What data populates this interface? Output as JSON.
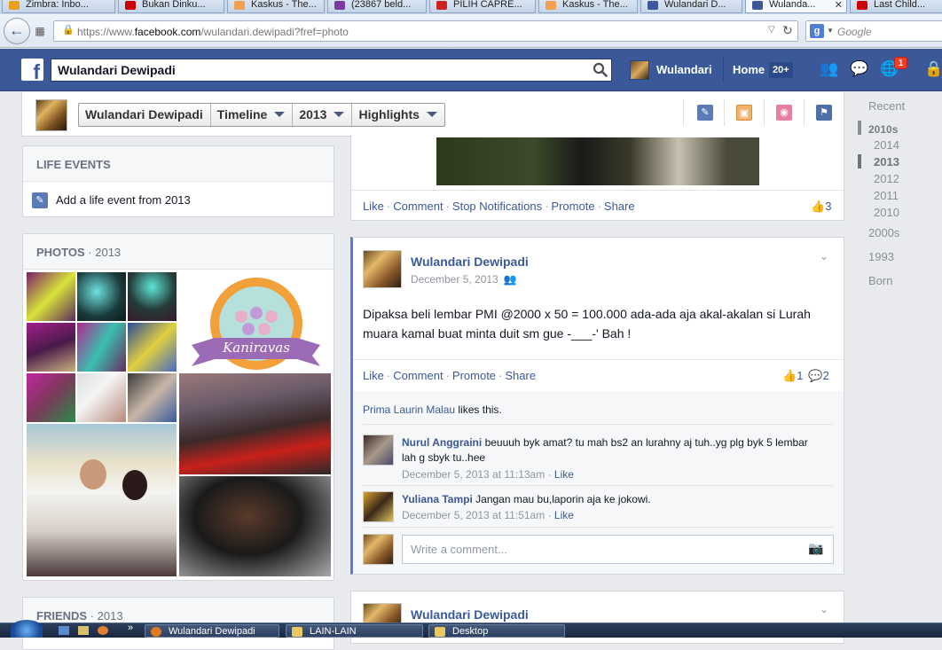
{
  "browser": {
    "tabs": [
      {
        "label": "Zimbra: Inbo...",
        "color": "#e8a020"
      },
      {
        "label": "Bukan Dinku...",
        "color": "#cc0000"
      },
      {
        "label": "Kaskus - The...",
        "color": "#f0a050"
      },
      {
        "label": "(23867 beld...",
        "color": "#7b3ca0"
      },
      {
        "label": "PILIH CAPRE...",
        "color": "#cc2222"
      },
      {
        "label": "Kaskus - The...",
        "color": "#f0a050"
      },
      {
        "label": "Wulandari D...",
        "color": "#3b5998"
      },
      {
        "label": "Wulanda...",
        "color": "#3b5998"
      },
      {
        "label": "Last Child...",
        "color": "#cc0000"
      }
    ],
    "url_prefix": "https://www.",
    "url_domain": "facebook.com",
    "url_rest": "/wulandari.dewipadi?fref=photo",
    "search_placeholder": "Google",
    "search_engine_letter": "g"
  },
  "fb": {
    "search_value": "Wulandari Dewipadi",
    "profile_name": "Wulandari",
    "home_label": "Home",
    "home_badge": "20+",
    "notif_count": "1"
  },
  "timeline_nav": {
    "name": "Wulandari Dewipadi",
    "section": "Timeline",
    "year": "2013",
    "filter": "Highlights"
  },
  "life_events": {
    "title": "LIFE EVENTS",
    "add_label": "Add a life event from 2013"
  },
  "photos": {
    "title": "PHOTOS",
    "year": "2013",
    "sticker_text": "Kaniravas"
  },
  "friends": {
    "title": "FRIENDS",
    "year": "2013"
  },
  "top_post": {
    "actions": [
      "Like",
      "Comment",
      "Stop Notifications",
      "Promote",
      "Share"
    ],
    "like_count": "3"
  },
  "post": {
    "author": "Wulandari Dewipadi",
    "date": "December 5, 2013",
    "text": "Dipaksa beli lembar PMI @2000 x 50 = 100.000 ada-ada aja akal-akalan si Lurah muara kamal buat minta duit sm gue -___-' Bah !",
    "actions": [
      "Like",
      "Comment",
      "Promote",
      "Share"
    ],
    "like_count": "1",
    "comment_count": "2",
    "likes_name": "Prima Laurin Malau",
    "likes_suffix": "likes this.",
    "comments": [
      {
        "name": "Nurul Anggraini",
        "text": "beuuuh byk amat? tu mah bs2 an lurahny aj tuh..yg plg byk 5 lembar lah g sbyk tu..hee",
        "time": "December 5, 2013 at 11:13am",
        "like": "Like"
      },
      {
        "name": "Yuliana Tampi",
        "text": "Jangan mau bu,laporin aja ke jokowi.",
        "time": "December 5, 2013 at 11:51am",
        "like": "Like"
      }
    ],
    "comment_placeholder": "Write a comment..."
  },
  "next_post": {
    "author": "Wulandari Dewipadi"
  },
  "scrubber": {
    "items": [
      "Recent",
      "2010s",
      "2014",
      "2013",
      "2012",
      "2011",
      "2010",
      "2000s",
      "1993",
      "Born"
    ]
  },
  "taskbar": {
    "items": [
      "Wulandari Dewipadi",
      "LAIN-LAIN",
      "Desktop"
    ]
  },
  "colors": {
    "fb_blue": "#3b5998",
    "link": "#3b5998",
    "bg": "#e9eaed"
  }
}
